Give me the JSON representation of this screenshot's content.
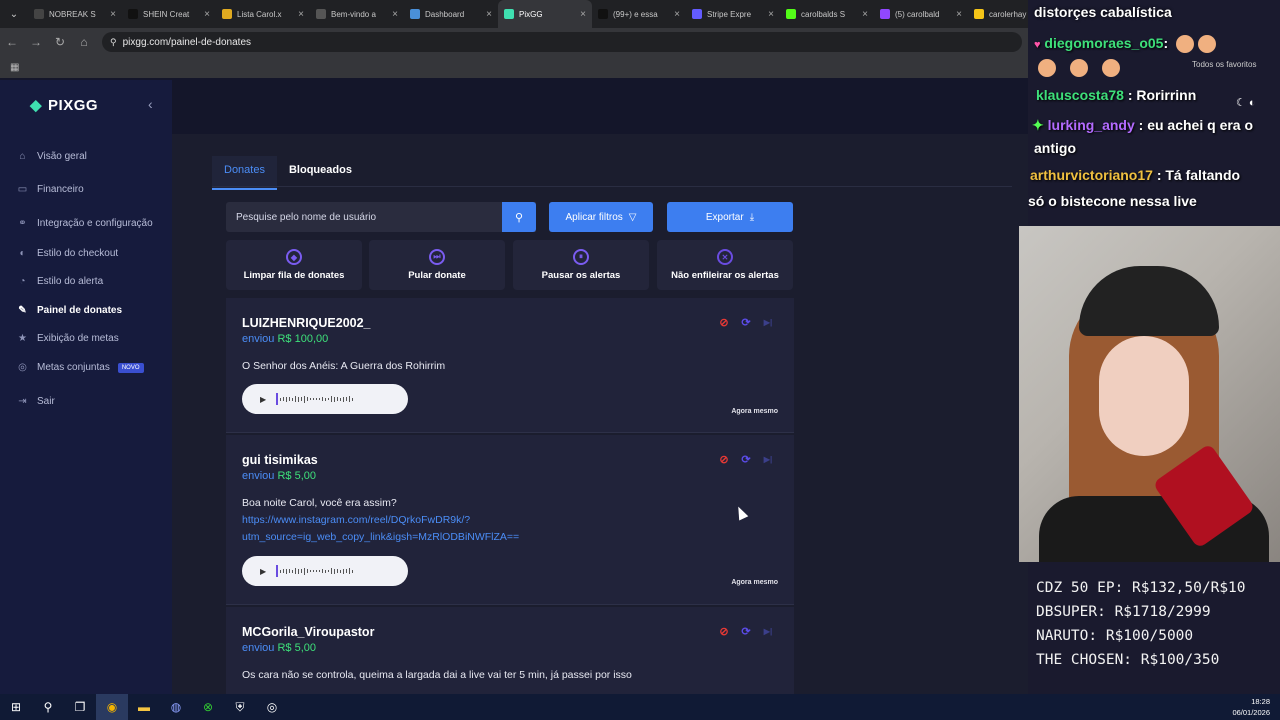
{
  "browser": {
    "tabs": [
      {
        "label": "NOBREAK S",
        "color": "#444"
      },
      {
        "label": "SHEIN Creat",
        "color": "#111"
      },
      {
        "label": "Lista Carol.x",
        "color": "#e0aa20"
      },
      {
        "label": "Bem-vindo a",
        "color": "#555"
      },
      {
        "label": "Dashboard",
        "color": "#4a90d9"
      },
      {
        "label": "PixGG",
        "color": "#3fe0b0"
      },
      {
        "label": "(99+) e essa",
        "color": "#111"
      },
      {
        "label": "Stripe Expre",
        "color": "#635bff"
      },
      {
        "label": "carolbalds S",
        "color": "#53fc18"
      },
      {
        "label": "(5) carolbald",
        "color": "#9147ff"
      },
      {
        "label": "carolerhay",
        "color": "#f5c518"
      }
    ],
    "url": "pixgg.com/painel-de-donates",
    "favorites_folder": "Todos os favoritos"
  },
  "sidebar": {
    "brand": "PIXGG",
    "items": [
      {
        "label": "Visão geral",
        "icon": "home-icon"
      },
      {
        "label": "Financeiro",
        "icon": "wallet-icon"
      },
      {
        "label": "Integração e configuração",
        "icon": "plug-icon"
      },
      {
        "label": "Estilo do checkout",
        "icon": "palette-icon"
      },
      {
        "label": "Estilo do alerta",
        "icon": "bell-icon"
      },
      {
        "label": "Painel de donates",
        "icon": "pen-icon"
      },
      {
        "label": "Exibição de metas",
        "icon": "star-icon"
      },
      {
        "label": "Metas conjuntas",
        "icon": "target-icon",
        "badge": "NOVO"
      },
      {
        "label": "Sair",
        "icon": "logout-icon"
      }
    ]
  },
  "panel": {
    "tabs": [
      "Donates",
      "Bloqueados"
    ],
    "search_placeholder": "Pesquise pelo nome de usuário",
    "filter_label": "Aplicar filtros",
    "export_label": "Exportar",
    "actions": [
      "Limpar fila de donates",
      "Pular donate",
      "Pausar os alertas",
      "Não enfileirar os alertas"
    ],
    "sent_prefix": "enviou",
    "donates": [
      {
        "name": "LUIZHENRIQUE2002_",
        "amount": "R$ 100,00",
        "message": "O Senhor dos Anéis: A Guerra dos Rohirrim",
        "link": "",
        "ago": "Agora mesmo"
      },
      {
        "name": "gui tisimikas",
        "amount": "R$ 5,00",
        "message": "Boa noite Carol, você era assim?",
        "link": "https://www.instagram.com/reel/DQrkoFwDR9k/?utm_source=ig_web_copy_link&igsh=MzRlODBiNWFlZA==",
        "link_line1": "https://www.instagram.com/reel/DQrkoFwDR9k/?",
        "link_line2": "utm_source=ig_web_copy_link&igsh=MzRlODBiNWFlZA==",
        "ago": "Agora mesmo"
      },
      {
        "name": "MCGorila_Viroupastor",
        "amount": "R$ 5,00",
        "message": "Os cara não se controla, queima a largada dai a live vai ter 5 min, já passei por isso",
        "link": "",
        "ago": ""
      }
    ]
  },
  "overlay": {
    "title": "distorçes cabalística",
    "chat": [
      {
        "user": "diegomoraes_o05",
        "text": ":",
        "user_color": "#3ee07a"
      },
      {
        "user": "klauscosta78",
        "text": ": Rorirrinn",
        "user_color": "#3ee07a"
      },
      {
        "user": "lurking_andy",
        "text": ": eu achei q era o",
        "user_color": "#b36bff"
      },
      {
        "user": "",
        "text": "antigo",
        "user_color": "#fff"
      },
      {
        "user": "arthurvictoriano17",
        "text": ": Tá faltando",
        "user_color": "#f0c040"
      },
      {
        "user": "",
        "text": "só o bistecone nessa live",
        "user_color": "#fff"
      }
    ],
    "goals": [
      "CDZ 50 EP: R$132,50/R$10",
      "DBSUPER: R$1718/2999",
      "NARUTO: R$100/5000",
      "THE CHOSEN: R$100/350"
    ]
  },
  "taskbar": {
    "time": "18:28",
    "date": "06/01/2026"
  }
}
